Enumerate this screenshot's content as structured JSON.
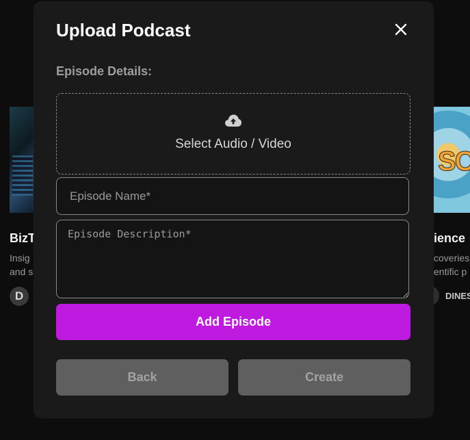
{
  "background": {
    "left_card": {
      "title": "BizT",
      "desc": "Insig and s",
      "avatar_letter": "D"
    },
    "right_card": {
      "title": "ience",
      "desc": "coveries entific p",
      "author": "DINES"
    }
  },
  "modal": {
    "title": "Upload Podcast",
    "close_icon": "close-icon",
    "section_label": "Episode Details:",
    "upload": {
      "icon": "cloud-upload-icon",
      "label": "Select Audio / Video"
    },
    "episode_name": {
      "placeholder": "Episode Name*",
      "value": ""
    },
    "episode_description": {
      "placeholder": "Episode Description*",
      "value": ""
    },
    "add_episode_label": "Add Episode",
    "back_label": "Back",
    "create_label": "Create"
  },
  "colors": {
    "accent": "#bf1adf",
    "modal_bg": "#1a1a1a",
    "disabled_button": "#5f5f5f"
  }
}
